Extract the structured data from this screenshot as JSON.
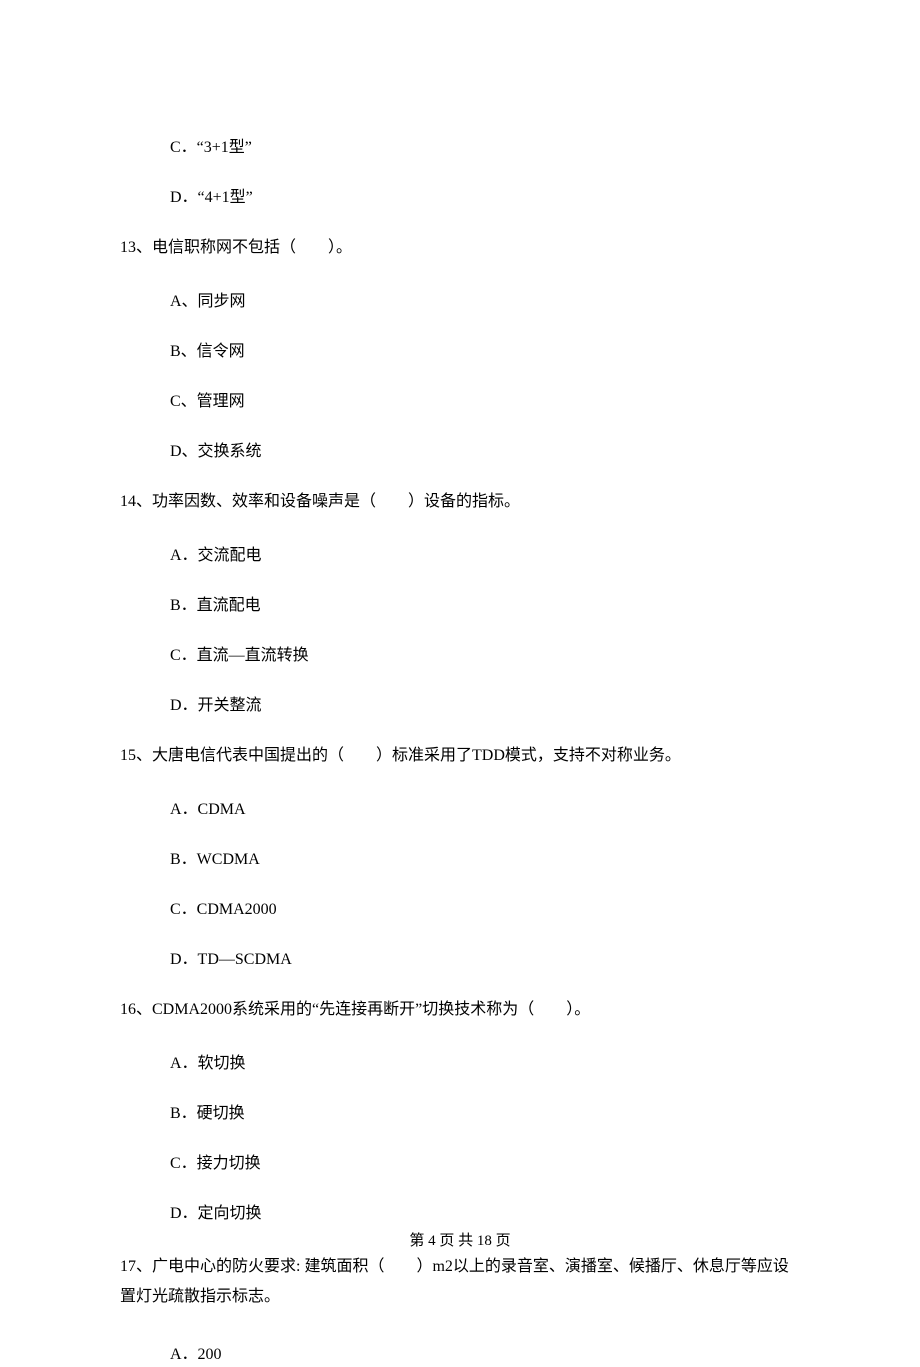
{
  "optC12": "C．“3+1型”",
  "optD12": "D．“4+1型”",
  "q13": "13、电信职称网不包括（　　）。",
  "q13a": "A、同步网",
  "q13b": "B、信令网",
  "q13c": "C、管理网",
  "q13d": "D、交换系统",
  "q14": "14、功率因数、效率和设备噪声是（　　）设备的指标。",
  "q14a": "A．交流配电",
  "q14b": "B．直流配电",
  "q14c": "C．直流—直流转换",
  "q14d": "D．开关整流",
  "q15": "15、大唐电信代表中国提出的（　　）标准采用了TDD模式，支持不对称业务。",
  "q15a": "A．CDMA",
  "q15b": "B．WCDMA",
  "q15c": "C．CDMA2000",
  "q15d": "D．TD—SCDMA",
  "q16": "16、CDMA2000系统采用的“先连接再断开”切换技术称为（　　）。",
  "q16a": "A．软切换",
  "q16b": "B．硬切换",
  "q16c": "C．接力切换",
  "q16d": "D．定向切换",
  "q17": "17、广电中心的防火要求: 建筑面积（　　）m2以上的录音室、演播室、候播厅、休息厅等应设置灯光疏散指示标志。",
  "q17a": "A．200",
  "footer": "第 4 页 共 18 页"
}
